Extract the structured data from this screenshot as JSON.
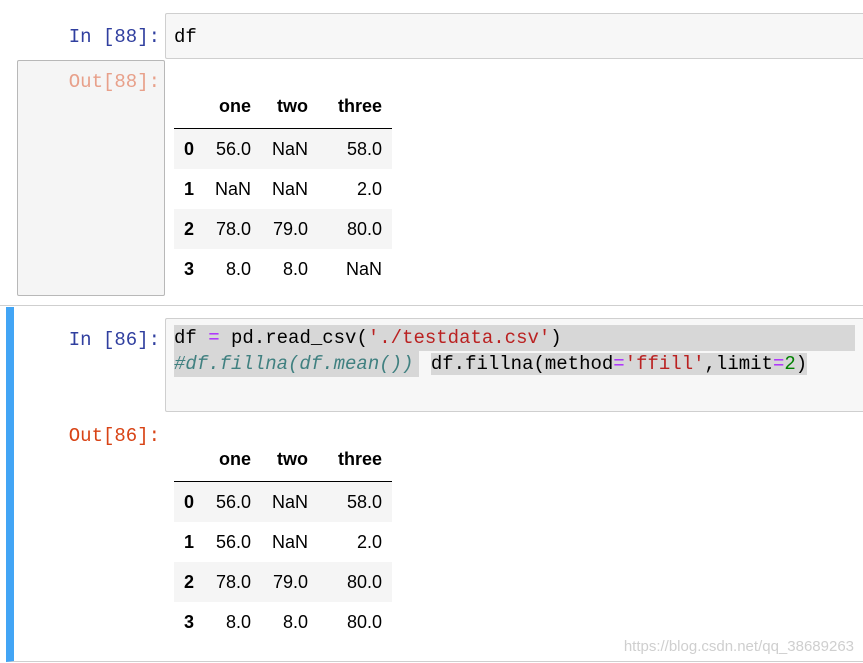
{
  "cells": [
    {
      "in_prompt": "In  [88]:",
      "out_prompt": "Out[88]:",
      "code": [
        "df"
      ],
      "output": {
        "columns": [
          "",
          "one",
          "two",
          "three"
        ],
        "rows": [
          {
            "index": "0",
            "one": "56.0",
            "two": "NaN",
            "three": "58.0"
          },
          {
            "index": "1",
            "one": "NaN",
            "two": "NaN",
            "three": "2.0"
          },
          {
            "index": "2",
            "one": "78.0",
            "two": "79.0",
            "three": "80.0"
          },
          {
            "index": "3",
            "one": "8.0",
            "two": "8.0",
            "three": "NaN"
          }
        ]
      }
    },
    {
      "in_prompt": "In  [86]:",
      "out_prompt": "Out[86]:",
      "code_tokens": {
        "l1": {
          "a": "df ",
          "op": "=",
          "b": " pd.read_csv(",
          "s": "'./testdata.csv'",
          "c": ")"
        },
        "l2": "#df.fillna(df.mean())",
        "l3": {
          "a": "df.fillna(method",
          "op": "=",
          "s": "'ffill'",
          "b": ",limit",
          "op2": "=",
          "n": "2",
          "c": ")"
        }
      },
      "output": {
        "columns": [
          "",
          "one",
          "two",
          "three"
        ],
        "rows": [
          {
            "index": "0",
            "one": "56.0",
            "two": "NaN",
            "three": "58.0"
          },
          {
            "index": "1",
            "one": "56.0",
            "two": "NaN",
            "three": "2.0"
          },
          {
            "index": "2",
            "one": "78.0",
            "two": "79.0",
            "three": "80.0"
          },
          {
            "index": "3",
            "one": "8.0",
            "two": "8.0",
            "three": "80.0"
          }
        ]
      }
    }
  ],
  "watermark": "https://blog.csdn.net/qq_38689263",
  "colors": {
    "selected_cell_bar": "#42a5f5",
    "in_prompt": "#303f9f",
    "out_prompt": "#d84315"
  }
}
